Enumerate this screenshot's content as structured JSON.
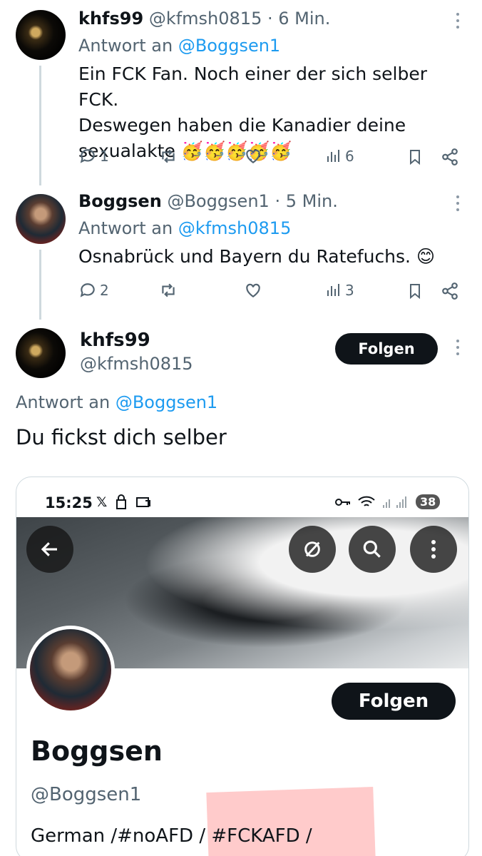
{
  "tweet1": {
    "display_name": "khfs99",
    "handle": "@kfmsh0815",
    "time": "· 6 Min.",
    "reply_prefix": "Antwort an",
    "reply_to": "@Boggsen1",
    "text_line1": "Ein FCK Fan. Noch einer der sich selber FCK.",
    "text_line2": "Deswegen haben die Kanadier deine",
    "text_line3": "sexualakte",
    "emojis": "🥳🥳🥳🥳🥳",
    "replies": "1",
    "views": "6"
  },
  "tweet2": {
    "display_name": "Boggsen",
    "handle": "@Boggsen1",
    "time": "· 5 Min.",
    "reply_prefix": "Antwort an",
    "reply_to": "@kfmsh0815",
    "text": "Osnabrück und Bayern du Ratefuchs.",
    "emoji": "😊",
    "replies": "2",
    "views": "3"
  },
  "main_tweet": {
    "display_name": "khfs99",
    "handle": "@kfmsh0815",
    "follow_label": "Folgen",
    "reply_prefix": "Antwort an",
    "reply_to": "@Boggsen1",
    "text": "Du fickst dich selber"
  },
  "embedded_screenshot": {
    "status_time": "15:25",
    "status_x": "𝕏",
    "battery": "38",
    "profile": {
      "follow_label": "Folgen",
      "display_name": "Boggsen",
      "handle": "@Boggsen1",
      "bio_part1": "German /#noAFD / ",
      "bio_part2": "#FCKAFD /"
    }
  },
  "icons": [
    "reply-icon",
    "retweet-icon",
    "like-icon",
    "views-icon",
    "bookmark-icon",
    "share-icon",
    "more-icon",
    "back-arrow-icon",
    "translate-icon",
    "search-icon"
  ],
  "colors": {
    "link": "#1d9bf0",
    "muted": "#536471",
    "button": "#0f1419"
  }
}
